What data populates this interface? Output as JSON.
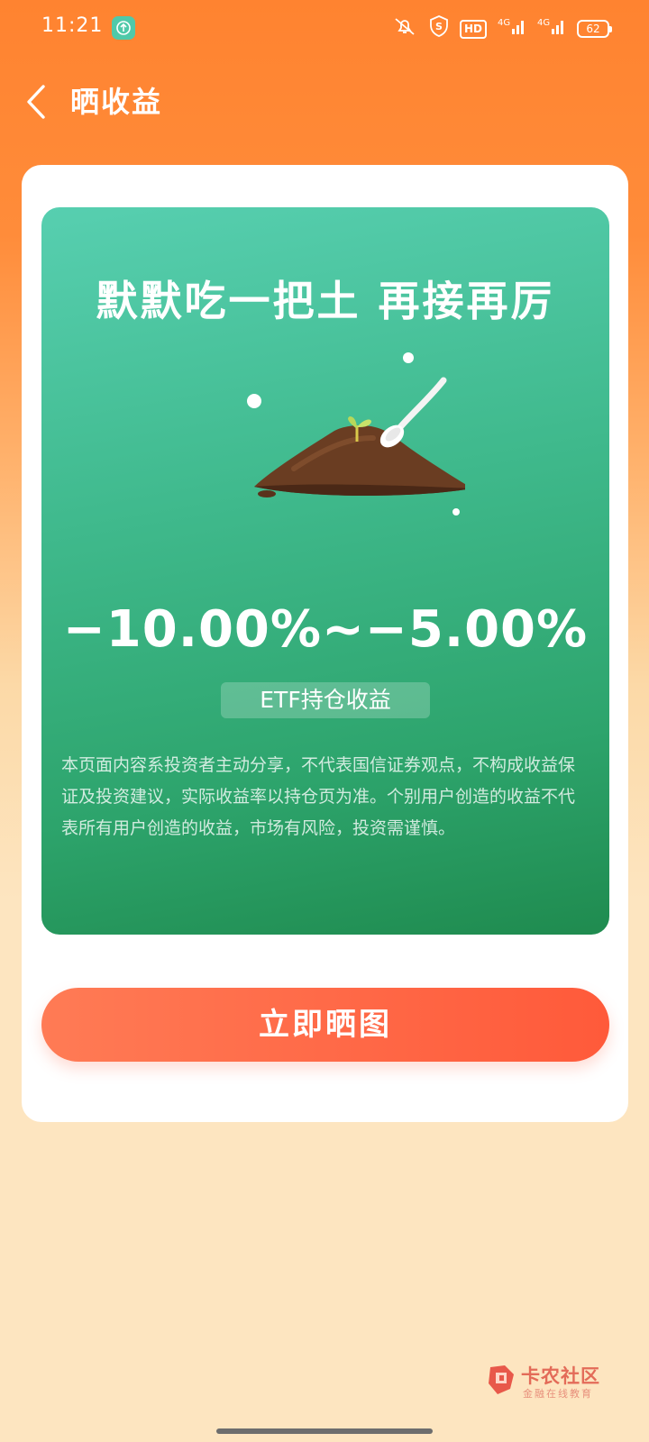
{
  "status_bar": {
    "time": "11:21",
    "network_1": "4G",
    "network_2": "4G",
    "battery": "62",
    "hd_label": "HD"
  },
  "header": {
    "title": "晒收益",
    "back_icon": "chevron-left-icon"
  },
  "card": {
    "headline": "默默吃一把土 再接再厉",
    "return_range": "−10.00%~−5.00%",
    "return_type": "ETF持仓收益",
    "disclaimer": "本页面内容系投资者主动分享，不代表国信证券观点，不构成收益保证及投资建议，实际收益率以持仓页为准。个别用户创造的收益不代表所有用户创造的收益，市场有风险，投资需谨慎。",
    "illustration": "dirt-pile-with-spoon"
  },
  "actions": {
    "share_label": "立即晒图"
  },
  "watermark": {
    "name": "卡农社区",
    "tagline": "金融在线教育"
  },
  "colors": {
    "header_orange": "#ff8330",
    "card_green_top": "#57cfb0",
    "card_green_bottom": "#1f8b4f",
    "button_red": "#ff5a3a",
    "page_bottom": "#fde5c0"
  }
}
